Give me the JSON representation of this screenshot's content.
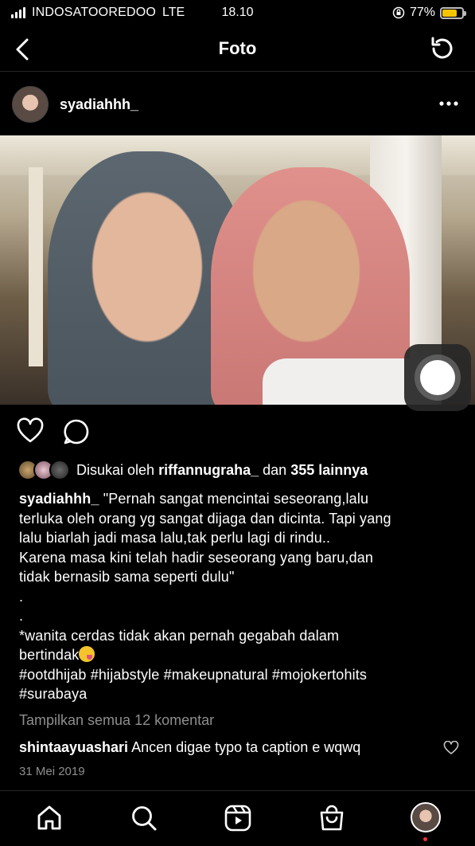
{
  "status_bar": {
    "carrier": "INDOSATOOREDOO",
    "network": "LTE",
    "time": "18.10",
    "battery_percent": "77%",
    "battery_level": 0.77,
    "battery_color": "#f5c400"
  },
  "nav": {
    "title": "Foto",
    "back_icon": "chevron-left-icon",
    "refresh_icon": "refresh-icon"
  },
  "post": {
    "username": "syadiahhh_",
    "more_icon": "more-horizontal-icon"
  },
  "likes": {
    "prefix": "Disukai oleh",
    "liker": "riffannugraha_",
    "connector": "dan",
    "others": "355 lainnya"
  },
  "caption": {
    "username": "syadiahhh_",
    "line1": "\"Pernah sangat mencintai seseorang,lalu",
    "line2": "terluka oleh orang yg sangat dijaga dan dicinta. Tapi yang",
    "line3": "lalu biarlah jadi masa lalu,tak perlu lagi di rindu..",
    "line4": "Karena masa kini telah hadir seseorang yang baru,dan",
    "line5": "tidak bernasib sama seperti dulu\"",
    "dot1": ".",
    "dot2": ".",
    "line6": "*wanita cerdas tidak akan pernah gegabah dalam",
    "line7": "bertindak",
    "hashtags1": "#ootdhijab #hijabstyle #makeupnatural #mojokertohits",
    "hashtags2": "#surabaya"
  },
  "comments": {
    "view_all": "Tampilkan semua 12 komentar",
    "user": "shintaayuashari",
    "text": "Ancen digae typo ta caption e wqwq"
  },
  "date": "31 Mei 2019",
  "tabbar": {
    "items": [
      "home-icon",
      "search-icon",
      "reels-icon",
      "shop-icon",
      "profile-avatar"
    ],
    "notification_color": "#ff3040"
  }
}
